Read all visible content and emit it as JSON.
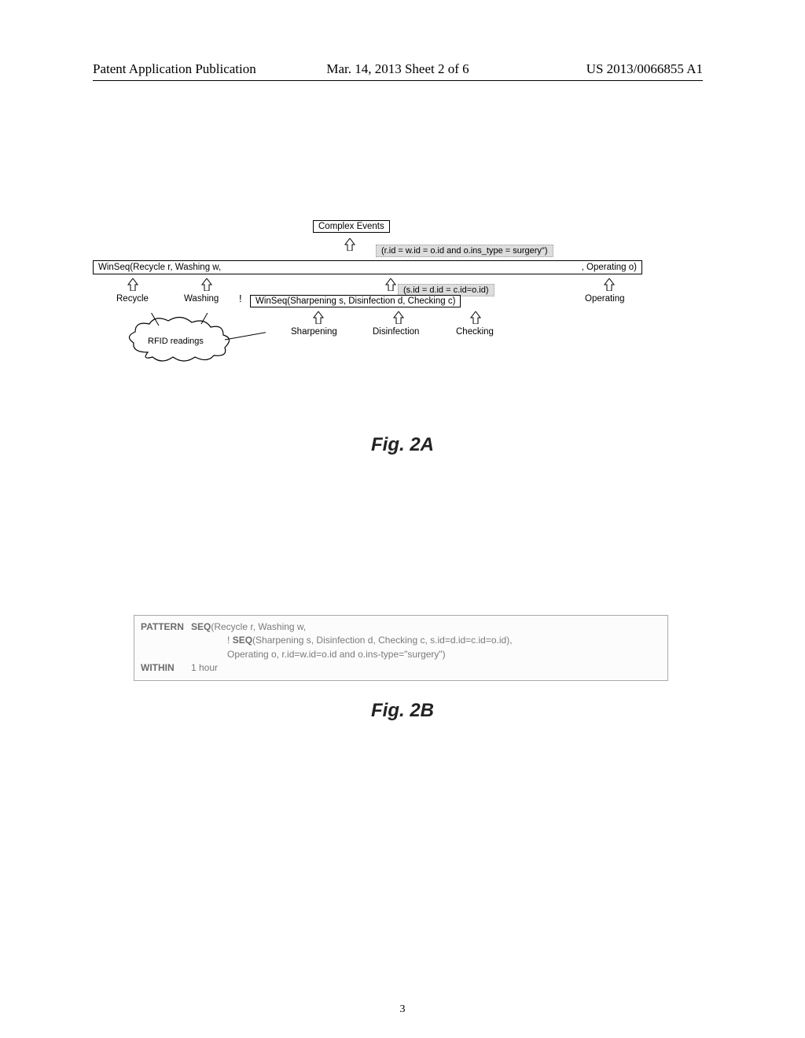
{
  "header": {
    "left": "Patent Application Publication",
    "center": "Mar. 14, 2013  Sheet 2 of 6",
    "right": "US 2013/0066855 A1"
  },
  "figA": {
    "complex_events": "Complex Events",
    "winseq_outer_left": "WinSeq(Recycle r, Washing w,",
    "winseq_outer_right": ", Operating o)",
    "predicate_outer": "(r.id = w.id = o.id and o.ins_type = surgery\")",
    "recycle": "Recycle",
    "washing": "Washing",
    "bang": "!",
    "winseq_inner": "WinSeq(Sharpening s, Disinfection d, Checking c)",
    "predicate_inner": "(s.id = d.id = c.id=o.id)",
    "operating": "Operating",
    "sharpening": "Sharpening",
    "disinfection": "Disinfection",
    "checking": "Checking",
    "rfid": "RFID readings",
    "caption": "Fig. 2A"
  },
  "figB": {
    "pattern_kw": "PATTERN",
    "seq_kw": "SEQ",
    "line1_tail": "(Recycle r, Washing w,",
    "line2_bang": "!",
    "line2_tail": "(Sharpening s, Disinfection d, Checking c, s.id=d.id=c.id=o.id),",
    "line3": "Operating o, r.id=w.id=o.id and o.ins-type=\"surgery\")",
    "within_kw": "WITHIN",
    "within_val": "1 hour",
    "caption": "Fig. 2B"
  },
  "page_number": "3"
}
